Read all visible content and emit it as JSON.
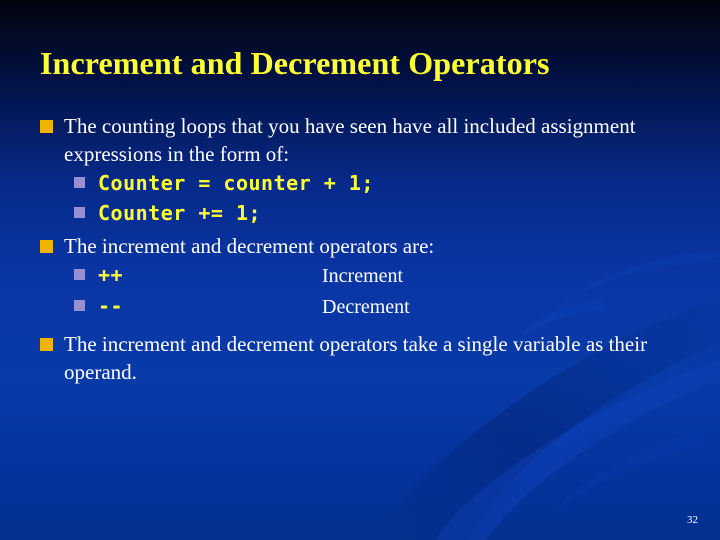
{
  "slide": {
    "title": "Increment and Decrement Operators",
    "page_number": "32",
    "colors": {
      "title_yellow": "#ffff33",
      "body_white": "#ffffff",
      "code_yellow": "#ffff33",
      "bullet_level1": "#f0b400",
      "bullet_level2": "#9a8ed2",
      "background_top": "#01040c",
      "background_bottom": "#04308f"
    },
    "bullets": [
      {
        "level": 1,
        "text": "The counting loops that you have seen have all included assignment expressions in the form of:"
      },
      {
        "level": 2,
        "code": "Counter = counter + 1;",
        "label": ""
      },
      {
        "level": 2,
        "code": "Counter += 1;",
        "label": ""
      },
      {
        "level": 1,
        "text": "The increment and decrement operators are:"
      },
      {
        "level": 2,
        "code": "++",
        "label": "Increment"
      },
      {
        "level": 2,
        "code": "--",
        "label": "Decrement"
      },
      {
        "level": 1,
        "text": "The increment and decrement operators take a single variable as their operand."
      }
    ]
  }
}
